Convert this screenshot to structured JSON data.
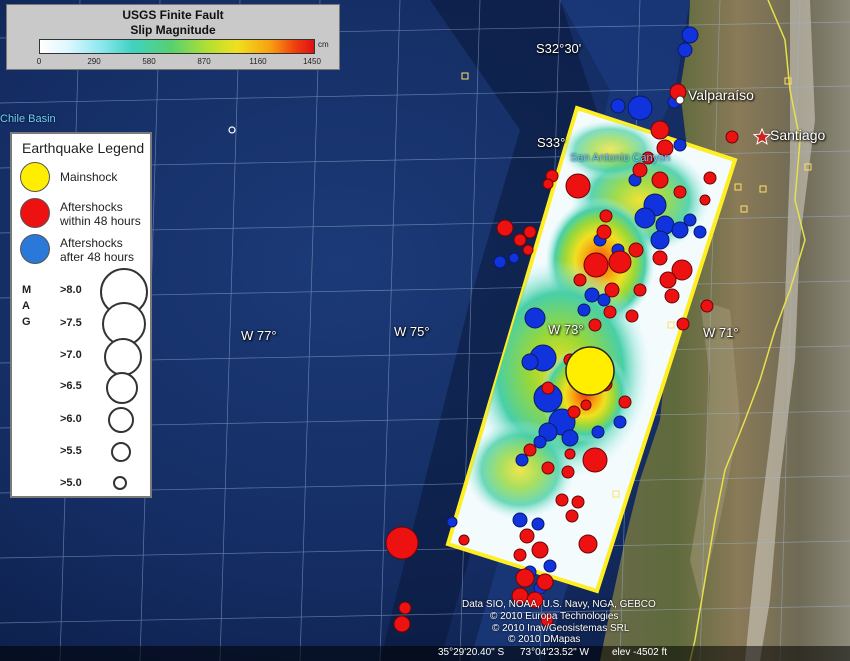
{
  "colorbar": {
    "title": "USGS Finite Fault",
    "subtitle": "Slip Magnitude",
    "unit": "cm",
    "ticks": [
      "0",
      "290",
      "580",
      "870",
      "1160",
      "1450"
    ],
    "range": [
      0,
      1450
    ]
  },
  "map_labels": {
    "lat_s3230": "S32°30'",
    "lat_s33": "S33°",
    "lon_w77": "W 77°",
    "lon_w75": "W 75°",
    "lon_w73": "W 73°",
    "lon_w71": "W 71°",
    "place_chile_basin": "Chile Basin",
    "place_valparaiso": "Valparaíso",
    "place_santiago": "Santiago",
    "place_san_antonio": "San Antonio Canyon"
  },
  "legend": {
    "title": "Earthquake Legend",
    "mainshock_label": "Mainshock",
    "aftershocks48_line1": "Aftershocks",
    "aftershocks48_line2": "within 48 hours",
    "aftershocksafter_line1": "Aftershocks",
    "aftershocksafter_line2": "after 48 hours",
    "mag_letters": [
      "M",
      "A",
      "G"
    ],
    "magnitudes": [
      ">8.0",
      ">7.5",
      ">7.0",
      ">6.5",
      ">6.0",
      ">5.5",
      ">5.0"
    ]
  },
  "colors": {
    "mainshock": "#ffee00",
    "aftershock_48h": "#ee1111",
    "aftershock_after": "#1133dd",
    "fault_outline": "#ffee22",
    "ocean": "#12285a",
    "border_line": "#e8e04a"
  },
  "credits": {
    "line1": "Data SIO, NOAA, U.S. Navy, NGA, GEBCO",
    "line2": "© 2010 Europa Technologies",
    "line3": "© 2010 Inav/Geosistemas SRL",
    "line4": "© 2010 DMapas"
  },
  "status": {
    "lat": "35°29'20.40\" S",
    "lon": "73°04'23.52\" W",
    "elev": "elev -4502 ft"
  }
}
